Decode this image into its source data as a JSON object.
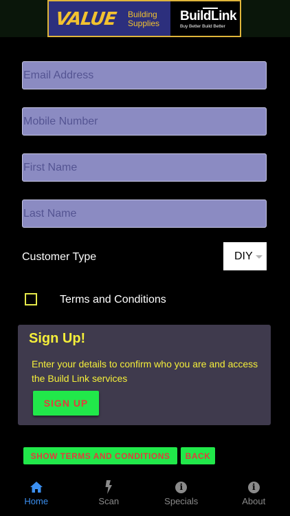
{
  "header": {
    "logo_value": "VALUE",
    "logo_building": "Building",
    "logo_supplies": "Supplies",
    "logo_buildlink": "BuildLink",
    "logo_tagline": "Buy Better Build Better"
  },
  "form": {
    "email_placeholder": "Email Address",
    "mobile_placeholder": "Mobile Number",
    "first_name_placeholder": "First Name",
    "last_name_placeholder": "Last Name",
    "customer_type_label": "Customer Type",
    "customer_type_value": "DIY",
    "terms_label": "Terms and Conditions"
  },
  "signup_card": {
    "title": "Sign Up!",
    "description": "Enter your details to confirm who you are and access the Build Link services",
    "button_label": "SIGN UP"
  },
  "actions": {
    "show_terms_label": "SHOW TERMS AND CONDITIONS",
    "back_label": "BACK"
  },
  "tabs": [
    {
      "label": "Home",
      "icon": "home-icon",
      "active": true
    },
    {
      "label": "Scan",
      "icon": "lightning-icon",
      "active": false
    },
    {
      "label": "Specials",
      "icon": "info-icon",
      "active": false
    },
    {
      "label": "About",
      "icon": "info-icon",
      "active": false
    }
  ],
  "colors": {
    "input_bg": "#8b8bc2",
    "card_bg": "#3f3a4d",
    "accent_yellow": "#f5ef3a",
    "button_green": "#21e84a",
    "button_text_red": "#e23c3c",
    "tab_active": "#3b8ff0",
    "tab_inactive": "#8a8a8a"
  }
}
